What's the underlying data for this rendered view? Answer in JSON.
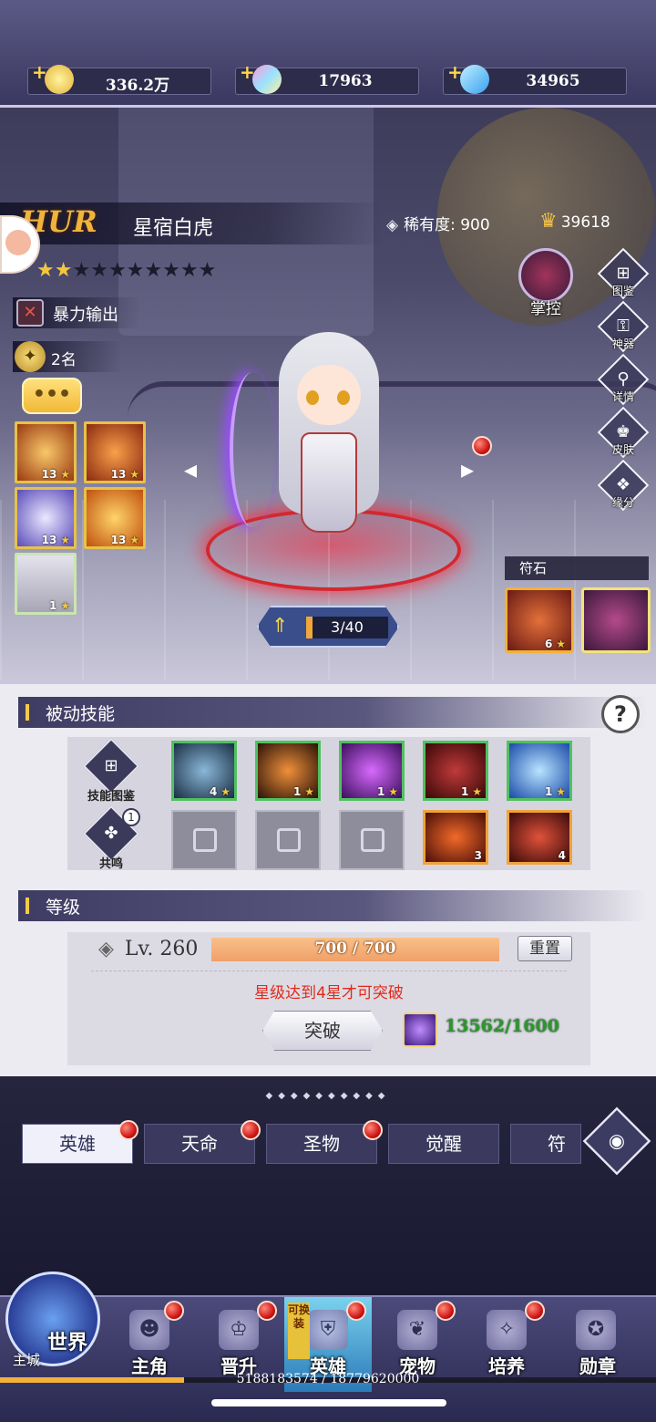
{
  "currency": [
    {
      "icon": "gold-coin-icon",
      "value": "336.2万"
    },
    {
      "icon": "rainbow-gem-icon",
      "value": "17963"
    },
    {
      "icon": "blue-diamond-icon",
      "value": "34965"
    }
  ],
  "hero": {
    "grade": "HUR",
    "name": "星宿白虎",
    "rarity_label": "稀有度:",
    "rarity_value": "900",
    "power": "39618",
    "stars_total": 10,
    "stars_filled": 2,
    "role": "暴力输出",
    "rank": "2名",
    "control_label": "掌控"
  },
  "side_menu": [
    {
      "icon": "codex-icon",
      "label": "图鉴"
    },
    {
      "icon": "artifact-icon",
      "label": "神器"
    },
    {
      "icon": "magnifier-icon",
      "label": "详情"
    },
    {
      "icon": "skin-icon",
      "label": "皮肤"
    },
    {
      "icon": "bond-icon",
      "label": "缘分"
    }
  ],
  "active_skills": [
    {
      "level": "13",
      "color": "#e3a03a"
    },
    {
      "level": "13",
      "color": "#e2581a"
    },
    {
      "level": "13",
      "color": "#8a7ad8"
    },
    {
      "level": "13",
      "color": "#f09a22"
    },
    {
      "level": "1",
      "color": "#b8b6c4"
    }
  ],
  "rune": {
    "title": "符石",
    "item_level": "6"
  },
  "exp": {
    "text": "3/40",
    "progress": 0.075
  },
  "passive": {
    "title": "被动技能",
    "side": [
      {
        "icon": "skill-codex-icon",
        "label": "技能图鉴"
      },
      {
        "icon": "resonance-icon",
        "label": "共鸣",
        "badge": "1"
      }
    ],
    "row1": [
      {
        "level": "4",
        "color": "#3f5f7a"
      },
      {
        "level": "1",
        "color": "#6a3a2a"
      },
      {
        "level": "1",
        "color": "#8a3aa8"
      },
      {
        "level": "1",
        "color": "#7a1e1e"
      },
      {
        "level": "1",
        "color": "#2b6ad8"
      }
    ],
    "row2_locked_count": 3,
    "row2_gold": [
      {
        "level": "3",
        "color": "#a23a1a"
      },
      {
        "level": "4",
        "color": "#8a2222"
      }
    ]
  },
  "level": {
    "title": "等级",
    "label": "Lv. 260",
    "bar_text": "700 / 700",
    "reset": "重置",
    "warning": "星级达到4星才可突破",
    "break_button": "突破",
    "cost": "13562/1600"
  },
  "tabs": [
    "英雄",
    "天命",
    "圣物",
    "觉醒",
    "符文"
  ],
  "nav": {
    "world": "世界",
    "home": "主城",
    "items": [
      "主角",
      "晋升",
      "英雄",
      "宠物",
      "培养",
      "勋章"
    ],
    "swap_tag": "可换装"
  },
  "footer_id": "5188183574 / 18779620000",
  "colors": {
    "accent_gold": "#f4c640",
    "warning_red": "#e02a1a",
    "cost_green": "#2e9430"
  }
}
